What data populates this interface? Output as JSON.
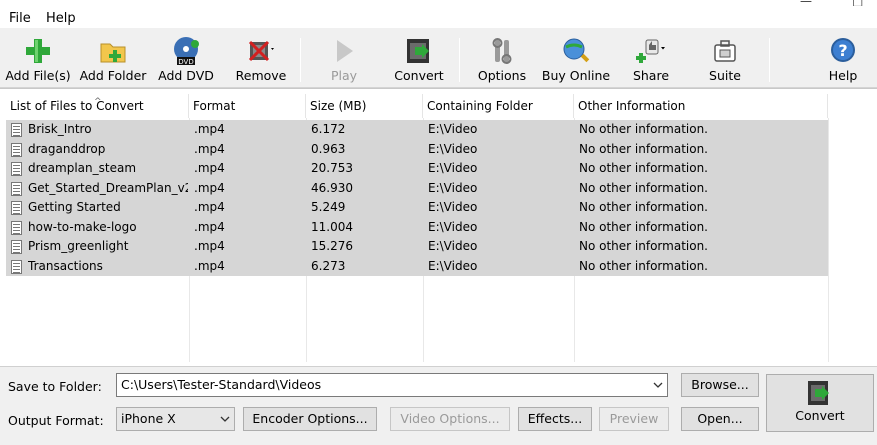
{
  "menu": {
    "file": "File",
    "help": "Help"
  },
  "toolbar": {
    "add_files": "Add File(s)",
    "add_folder": "Add Folder",
    "add_dvd": "Add DVD",
    "dvd_badge": "DVD",
    "remove": "Remove",
    "play": "Play",
    "convert": "Convert",
    "options": "Options",
    "buy_online": "Buy Online",
    "share": "Share",
    "suite": "Suite",
    "help": "Help"
  },
  "table": {
    "columns": [
      "List of Files to Convert",
      "Format",
      "Size (MB)",
      "Containing Folder",
      "Other Information"
    ],
    "rows": [
      {
        "name": "Brisk_Intro",
        "format": ".mp4",
        "size": "6.172",
        "folder": "E:\\Video",
        "info": "No other information."
      },
      {
        "name": "draganddrop",
        "format": ".mp4",
        "size": "0.963",
        "folder": "E:\\Video",
        "info": "No other information."
      },
      {
        "name": "dreamplan_steam",
        "format": ".mp4",
        "size": "20.753",
        "folder": "E:\\Video",
        "info": "No other information."
      },
      {
        "name": "Get_Started_DreamPlan_v2",
        "format": ".mp4",
        "size": "46.930",
        "folder": "E:\\Video",
        "info": "No other information."
      },
      {
        "name": "Getting Started",
        "format": ".mp4",
        "size": "5.249",
        "folder": "E:\\Video",
        "info": "No other information."
      },
      {
        "name": "how-to-make-logo",
        "format": ".mp4",
        "size": "11.004",
        "folder": "E:\\Video",
        "info": "No other information."
      },
      {
        "name": "Prism_greenlight",
        "format": ".mp4",
        "size": "15.276",
        "folder": "E:\\Video",
        "info": "No other information."
      },
      {
        "name": "Transactions",
        "format": ".mp4",
        "size": "6.273",
        "folder": "E:\\Video",
        "info": "No other information."
      }
    ]
  },
  "bottom": {
    "save_label": "Save to Folder:",
    "save_path": "C:\\Users\\Tester-Standard\\Videos",
    "browse": "Browse...",
    "format_label": "Output Format:",
    "format_value": "iPhone X",
    "encoder": "Encoder Options...",
    "video_options": "Video Options...",
    "effects": "Effects...",
    "preview": "Preview",
    "open": "Open...",
    "convert": "Convert"
  },
  "colors": {
    "selected_row": "#d6d6d6",
    "accent_green": "#2fa83a",
    "remove_red": "#d32020"
  }
}
